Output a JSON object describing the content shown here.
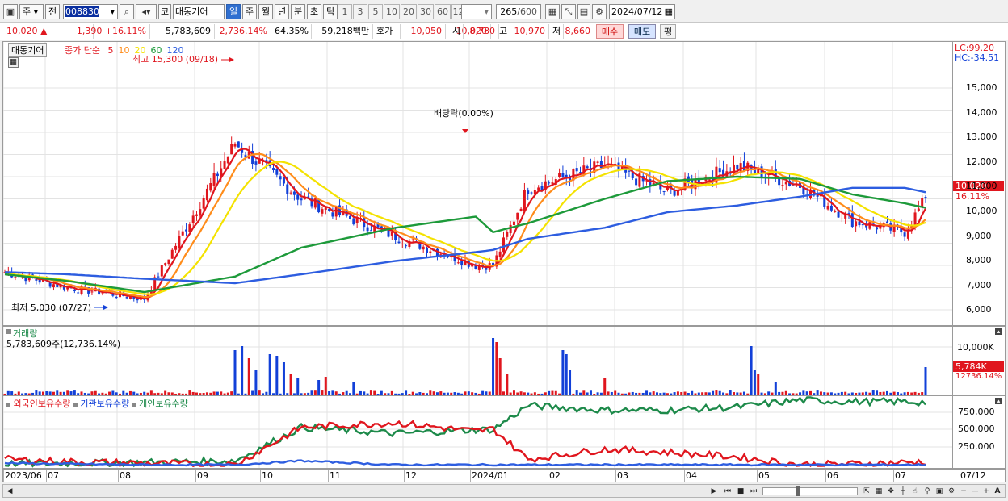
{
  "toolbar": {
    "market_select": "주",
    "prev_label": "전",
    "stock_code": "008830",
    "stock_prefix": "코",
    "stock_name": "대동기어",
    "periods": [
      "일",
      "주",
      "월",
      "년",
      "분",
      "초",
      "틱"
    ],
    "active_period": "일",
    "intervals": [
      "1",
      "3",
      "5",
      "10",
      "20",
      "30",
      "60",
      "120"
    ],
    "count_value": "265",
    "count_total": "/600",
    "date_value": "2024/07/12"
  },
  "info": {
    "price": "10,020",
    "change_arrow": "▲",
    "change": "1,390",
    "change_pct": "+16.11%",
    "volume": "5,783,609",
    "volume_pct": "2,736.14%",
    "turnover_pct": "64.35%",
    "trade_amount": "59,218백만",
    "bid_label": "호가",
    "bid1": "10,050",
    "bid2": "10,020",
    "open_label": "시",
    "open": "8,780",
    "high_label": "고",
    "high": "10,970",
    "low_label": "저",
    "low": "8,660",
    "buy_label": "매수",
    "sell_label": "매도",
    "avg_label": "평"
  },
  "price_pane": {
    "stock_tag": "대동기어",
    "ma_title": "종가 단순",
    "ma_periods": [
      "5",
      "10",
      "20",
      "60",
      "120"
    ],
    "ma_colors": [
      "#e0161e",
      "#ff8c1a",
      "#f4e200",
      "#1d9a3a",
      "#2d5de0"
    ],
    "high_note": "최고 15,300 (09/18)",
    "low_note": "최저 5,030 (07/27)",
    "dividend_note": "배당락(0.00%)",
    "lc_label": "LC:99.20",
    "hc_label": "HC:-34.51",
    "current_price_tag": "10,020",
    "current_pct_tag": "16.11%",
    "y_ticks": [
      "15,000",
      "14,000",
      "13,000",
      "12,000",
      "11,000",
      "10,000",
      "9,000",
      "8,000",
      "7,000",
      "6,000",
      "5,000"
    ]
  },
  "volume_pane": {
    "title": "거래량",
    "summary": "5,783,609주(12,736.14%)",
    "y_tick": "10,000K",
    "current_tag": "5,784K",
    "current_pct": "12736.14%"
  },
  "holding_pane": {
    "series_labels": [
      "외국인보유수량",
      "기관보유수량",
      "개인보유수량"
    ],
    "series_colors": [
      "#e0161e",
      "#2d5de0",
      "#1d8a4a"
    ],
    "y_ticks": [
      "750,000",
      "500,000",
      "250,000"
    ]
  },
  "x_axis": {
    "labels": [
      "2023/06",
      "07",
      "08",
      "09",
      "10",
      "11",
      "12",
      "2024/01",
      "02",
      "03",
      "04",
      "05",
      "06",
      "07"
    ],
    "right_label": "07/12"
  },
  "chart_data": [
    {
      "type": "candlestick",
      "title": "대동기어 종가 단순 5 10 20 60 120",
      "x_range": [
        "2023/06",
        "2024/07/12"
      ],
      "ylim": [
        4700,
        15600
      ],
      "series": [
        {
          "name": "종가 (approx. trend)",
          "x": [
            "2023/06",
            "2023/07",
            "2023/08",
            "2023/09/18",
            "2023/10",
            "2023/11",
            "2023/12",
            "2023/12/20",
            "2024/01",
            "2024/02",
            "2024/03",
            "2024/04",
            "2024/05",
            "2024/06",
            "2024/07",
            "2024/07/12"
          ],
          "values": [
            6700,
            6000,
            5500,
            12500,
            10000,
            8300,
            7000,
            7000,
            10500,
            11500,
            10300,
            11500,
            10600,
            9000,
            8500,
            10020
          ]
        },
        {
          "name": "60",
          "values": [
            6600,
            6300,
            5800,
            6500,
            7800,
            8700,
            9200,
            8500,
            8900,
            10000,
            10800,
            11000,
            10900,
            10200,
            9800,
            9600
          ]
        },
        {
          "name": "120",
          "values": [
            6700,
            6600,
            6400,
            6200,
            6600,
            7200,
            7600,
            7700,
            8200,
            8700,
            9400,
            9700,
            10100,
            10500,
            10500,
            10300
          ]
        }
      ],
      "annotations": [
        "최고 15,300 (09/18)",
        "최저 5,030 (07/27)",
        "배당락(0.00%)"
      ]
    },
    {
      "type": "bar",
      "title": "거래량",
      "last_value": 5783609
    },
    {
      "type": "line",
      "title": "외국인보유수량 / 기관보유수량 / 개인보유수량",
      "ylim": [
        0,
        900000
      ],
      "series": [
        {
          "name": "외국인보유수량",
          "values": [
            90000,
            60000,
            40000,
            20000,
            500000,
            560000,
            450000,
            480000,
            90000,
            220000,
            180000,
            120000,
            20000,
            30000,
            50000,
            60000
          ]
        },
        {
          "name": "기관보유수량",
          "values": [
            40000,
            30000,
            20000,
            20000,
            70000,
            20000,
            20000,
            20000,
            20000,
            20000,
            20000,
            20000,
            20000,
            20000,
            20000,
            20000
          ]
        },
        {
          "name": "개인보유수량",
          "values": [
            30000,
            40000,
            50000,
            70000,
            500000,
            420000,
            470000,
            470000,
            780000,
            720000,
            720000,
            760000,
            850000,
            830000,
            830000,
            820000
          ]
        }
      ]
    }
  ]
}
